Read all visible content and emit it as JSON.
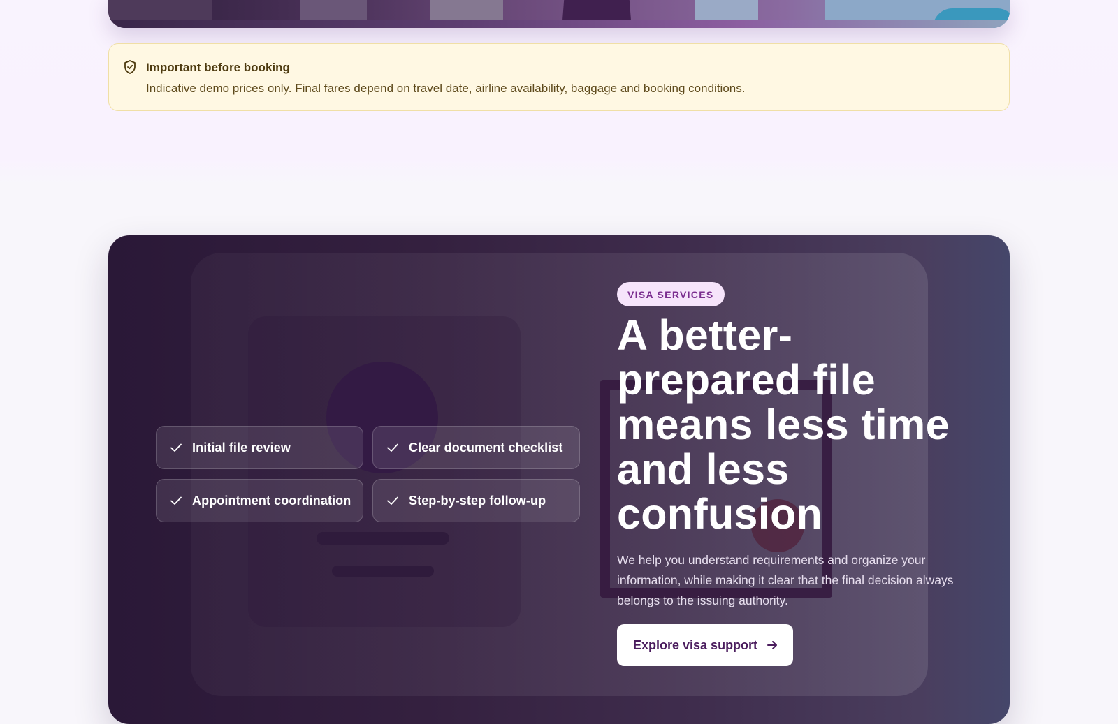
{
  "notice": {
    "icon": "shield-check-icon",
    "title": "Important before booking",
    "text": "Indicative demo prices only. Final fares depend on travel date, airline availability, baggage and booking conditions."
  },
  "visa": {
    "badge": "VISA SERVICES",
    "headline": "A better-prepared file means less time and less confusion",
    "description": "We help you understand requirements and organize your information, while making it clear that the final decision always belongs to the issuing authority.",
    "cta_label": "Explore visa support",
    "cta_icon": "arrow-right-icon",
    "features": [
      {
        "label": "Initial file review",
        "icon": "check-icon"
      },
      {
        "label": "Clear document checklist",
        "icon": "check-icon"
      },
      {
        "label": "Appointment coordination",
        "icon": "check-icon"
      },
      {
        "label": "Step-by-step follow-up",
        "icon": "check-icon"
      }
    ]
  },
  "colors": {
    "accent": "#4b1d5e",
    "badge_bg": "#f6e4fb",
    "badge_text": "#7a2d8f",
    "notice_bg": "#fff8e3",
    "notice_border": "#f0dfa6",
    "card_dark": "#2a1837"
  }
}
